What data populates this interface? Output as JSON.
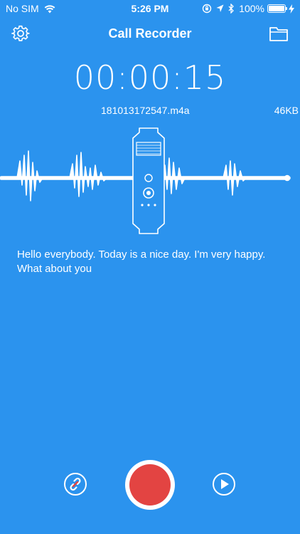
{
  "status_bar": {
    "carrier": "No SIM",
    "time": "5:26 PM",
    "battery": "100%",
    "icons": [
      "wifi-icon",
      "orientation-lock-icon",
      "location-icon",
      "bluetooth-icon",
      "battery-icon",
      "charging-icon"
    ]
  },
  "nav": {
    "title": "Call Recorder",
    "left_icon": "gear-icon",
    "right_icon": "folder-icon"
  },
  "recording": {
    "timer": "00:00:15",
    "file_name": "181013172547.m4a",
    "file_size": "46KB"
  },
  "transcript": {
    "text": "Hello everybody. Today is a nice day. I'm very happy. What about you"
  },
  "controls": {
    "left_icon": "link-icon",
    "center_icon": "record-icon",
    "right_icon": "play-icon"
  },
  "colors": {
    "background": "#2b93ee",
    "foreground": "#ffffff",
    "record": "#e34442"
  }
}
